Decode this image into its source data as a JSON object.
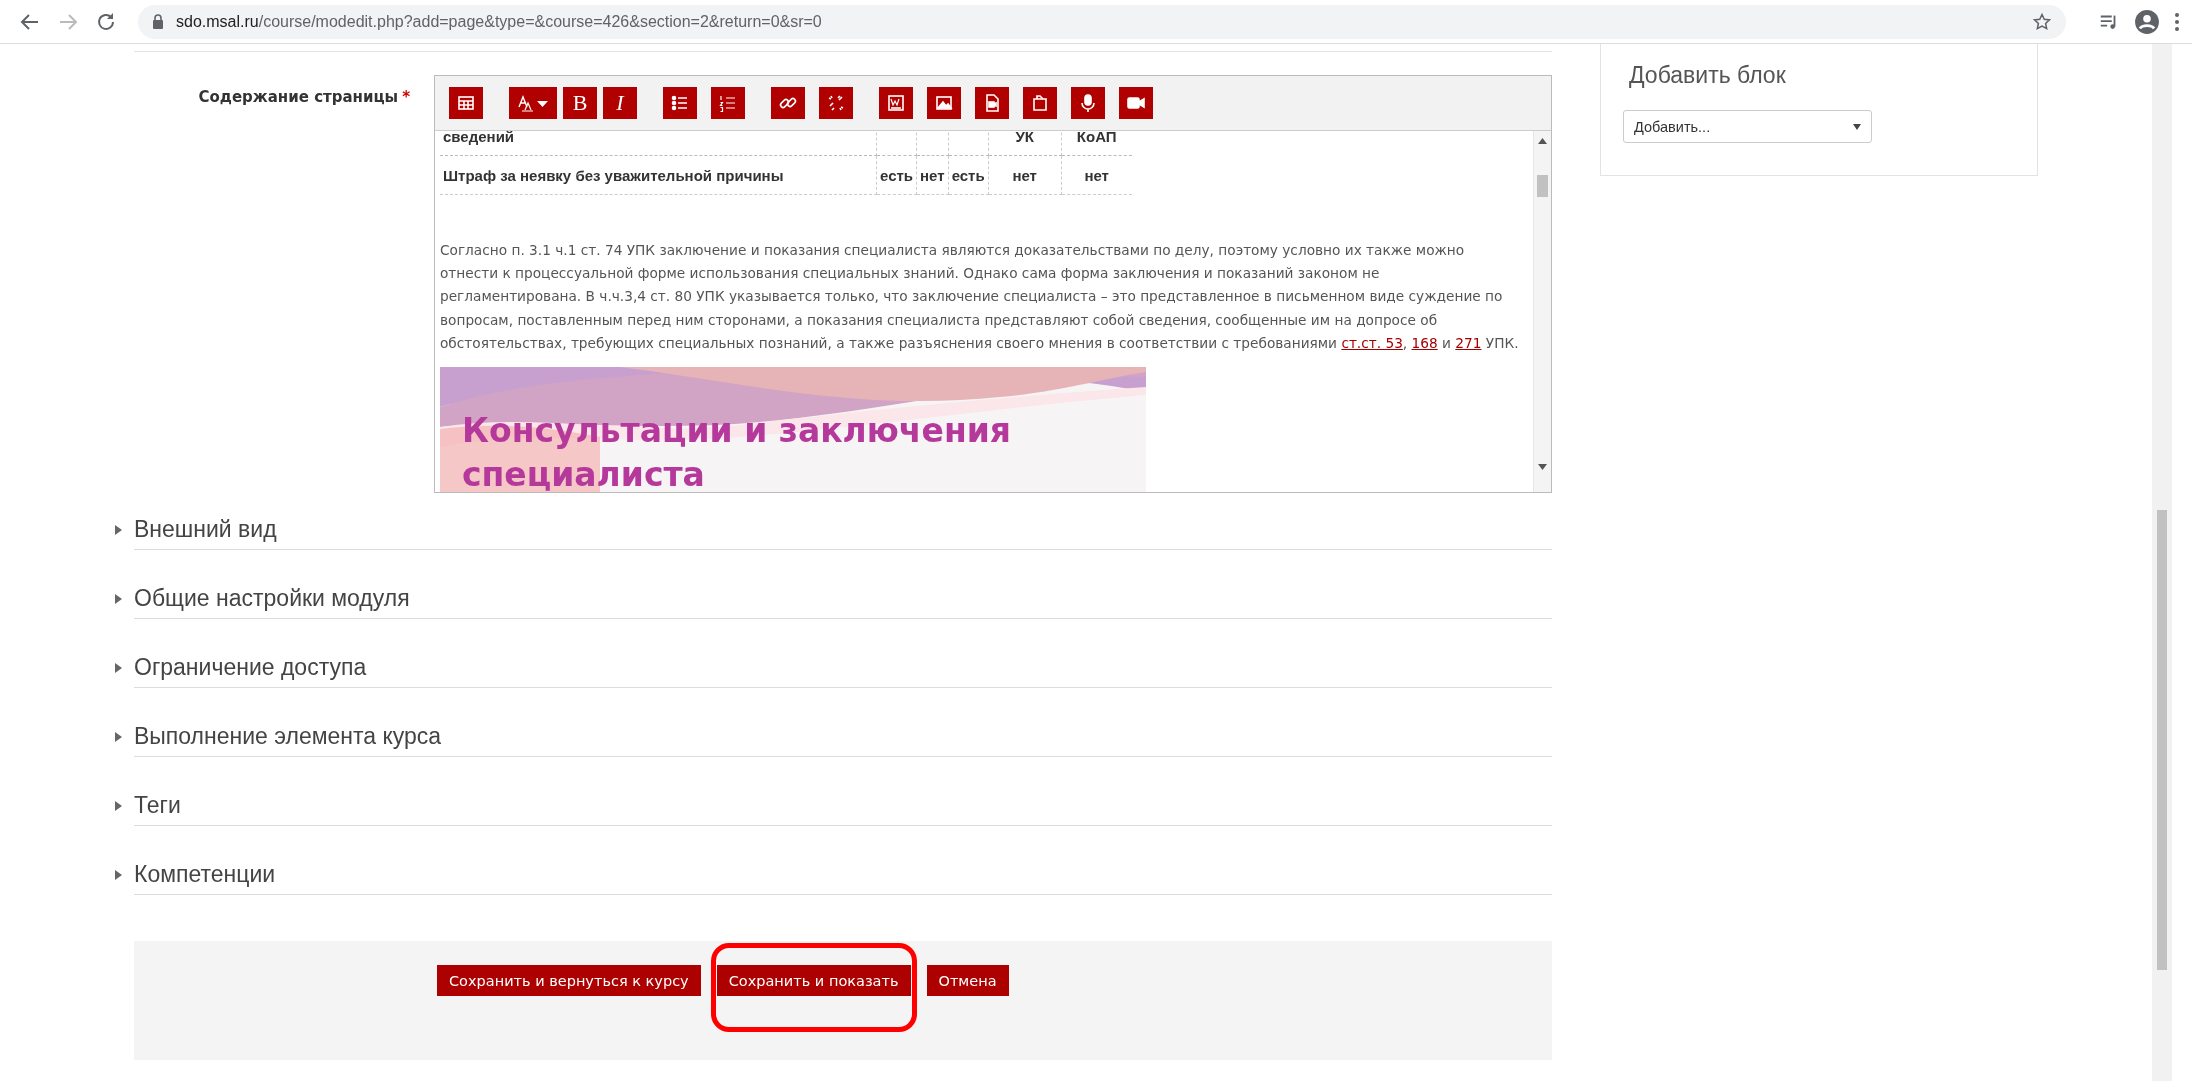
{
  "browser": {
    "url_host": "sdo.msal.ru",
    "url_path": "/course/modedit.php?add=page&type=&course=426&section=2&return=0&sr=0"
  },
  "content_field": {
    "label": "Содержание страницы",
    "required": true,
    "required_mark": "*",
    "toolbar": {
      "bold": "B",
      "italic": "I"
    },
    "table_rows": [
      {
        "column_1": "сведений",
        "column_5": "УК",
        "column_6": "КоАП"
      },
      {
        "column_1": "Штраф за неявку без уважительной причины",
        "column_2": "есть",
        "column_3": "нет",
        "column_4": "есть",
        "column_5": "нет",
        "column_6": "нет"
      }
    ],
    "paragraph": [
      {
        "kind": "text",
        "text": "Согласно п. 3.1 ч.1 ст. 74 УПК заключение и показания специалиста являются доказательствами по делу, поэтому условно их также можно отнести к процессуальной форме использования специальных знаний. Однако сама форма заключения и показаний законом не регламентирована. В ч.ч.3,4 ст. 80 УПК указывается только, что заключение специалиста – это представленное в письменном виде суждение по вопросам, поставленным перед ним сторонами, а показания специалиста представляют собой сведения, сообщенные им на допросе об обстоятельствах, требующих специальных познаний, а также разъяснения своего мнения в соответствии с требованиями "
      },
      {
        "kind": "link",
        "text": "ст.ст. 53"
      },
      {
        "kind": "text",
        "text": ", "
      },
      {
        "kind": "link",
        "text": "168"
      },
      {
        "kind": "text",
        "text": " и "
      },
      {
        "kind": "link",
        "text": "271"
      },
      {
        "kind": "text",
        "text": " УПК."
      }
    ],
    "banner": {
      "lines": [
        "Консультации и заключения",
        "специалиста"
      ]
    }
  },
  "sections": [
    {
      "title": "Внешний вид",
      "expanded": false
    },
    {
      "title": "Общие настройки модуля",
      "expanded": false
    },
    {
      "title": "Ограничение доступа",
      "expanded": false
    },
    {
      "title": "Выполнение элемента курса",
      "expanded": false
    },
    {
      "title": "Теги",
      "expanded": false
    },
    {
      "title": "Компетенции",
      "expanded": false
    }
  ],
  "buttons": [
    {
      "label": "Сохранить и вернуться к курсу",
      "highlighted": false
    },
    {
      "label": "Сохранить и показать",
      "highlighted": true
    },
    {
      "label": "Отмена",
      "highlighted": false
    }
  ],
  "add_block": {
    "title": "Добавить блок",
    "select_value": "Добавить..."
  }
}
